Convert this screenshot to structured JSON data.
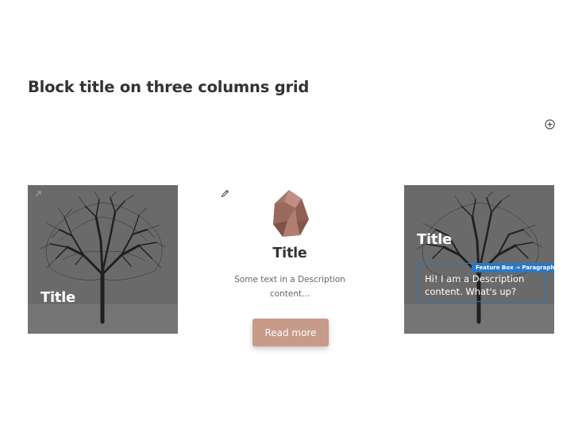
{
  "page": {
    "heading": "Block title on three columns grid",
    "add_block_icon": "plus-circle-icon"
  },
  "columns": [
    {
      "type": "image-card",
      "title": "Title",
      "image": "bare-tree-winter-photo",
      "icon": "link-icon"
    },
    {
      "type": "feature-card",
      "edit_icon": "pencil-icon",
      "image": "faceted-gem-rock",
      "title": "Title",
      "description": "Some text in a Description content...",
      "button_label": "Read more",
      "button_color": "#c79a89"
    },
    {
      "type": "image-card",
      "title": "Title",
      "description": "Hi! I am a Description content. What's up?",
      "selection_tag": "Feature Box → Paragraph",
      "selection_color": "#2a78c5",
      "image": "bare-tree-winter-photo"
    }
  ]
}
